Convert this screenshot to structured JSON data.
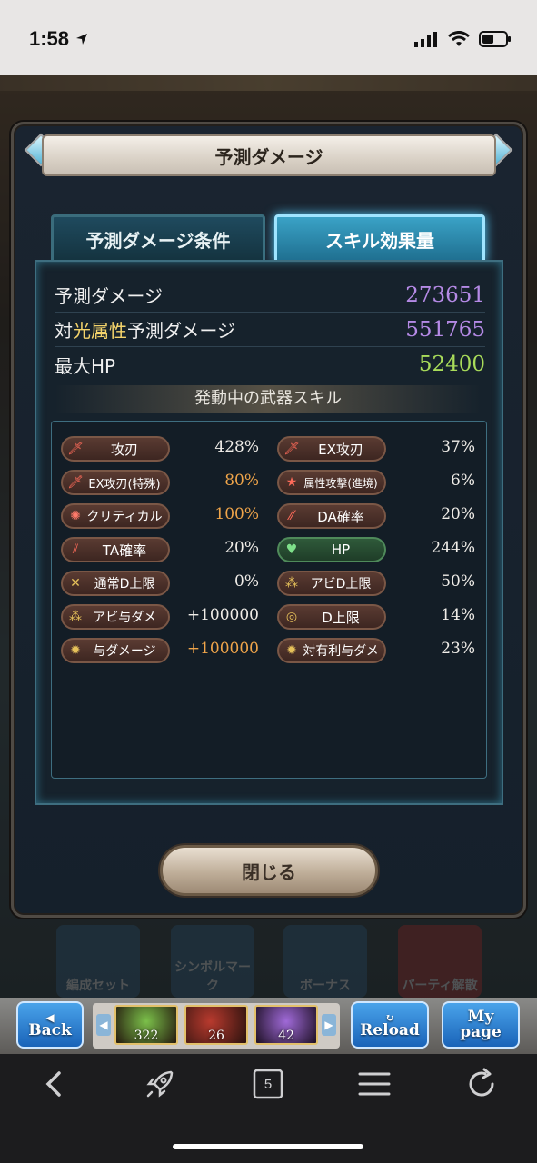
{
  "status_bar": {
    "time": "1:58"
  },
  "background": {
    "ghost_buttons": [
      "編成セット",
      "シンボルマーク",
      "ボーナス",
      "パーティ解散"
    ]
  },
  "modal": {
    "title": "予測ダメージ",
    "tabs": [
      {
        "label": "予測ダメージ条件",
        "active": false
      },
      {
        "label": "スキル効果量",
        "active": true
      }
    ],
    "stats": [
      {
        "label": "予測ダメージ",
        "value": "273651",
        "color": "#b58ae6"
      },
      {
        "label_prefix": "対",
        "label_highlight": "光属性",
        "label_suffix": "予測ダメージ",
        "value": "551765",
        "color": "#b58ae6"
      },
      {
        "label": "最大HP",
        "value": "52400",
        "color": "#a9dc5a"
      }
    ],
    "section_title": "発動中の武器スキル",
    "skills_left": [
      {
        "name": "攻刃",
        "value": "428%",
        "icon": "sword-icon"
      },
      {
        "name": "EX攻刃(特殊)",
        "value": "80%",
        "icon": "sword-icon",
        "value_color": "orange"
      },
      {
        "name": "クリティカル",
        "value": "100%",
        "icon": "burst-icon",
        "value_color": "orange"
      },
      {
        "name": "TA確率",
        "value": "20%",
        "icon": "triple-slash-icon"
      },
      {
        "name": "通常D上限",
        "value": "0%",
        "icon": "cap-icon"
      },
      {
        "name": "アビ与ダメ",
        "value": "+100000",
        "icon": "ability-icon"
      },
      {
        "name": "与ダメージ",
        "value": "+100000",
        "icon": "ring-icon",
        "value_color": "orange"
      }
    ],
    "skills_right": [
      {
        "name": "EX攻刃",
        "value": "37%",
        "icon": "sword-icon"
      },
      {
        "name": "属性攻撃(進境)",
        "value": "6%",
        "icon": "star-icon"
      },
      {
        "name": "DA確率",
        "value": "20%",
        "icon": "double-slash-icon"
      },
      {
        "name": "HP",
        "value": "244%",
        "icon": "heart-icon",
        "style": "green"
      },
      {
        "name": "アビD上限",
        "value": "50%",
        "icon": "ability-cap-icon"
      },
      {
        "name": "D上限",
        "value": "14%",
        "icon": "ring-icon"
      },
      {
        "name": "対有利与ダメ",
        "value": "23%",
        "icon": "gear-ring-icon"
      }
    ],
    "close_label": "閉じる"
  },
  "game_nav": {
    "back_label": "Back",
    "reload_label": "Reload",
    "mypage_label_top": "My",
    "mypage_label_bottom": "page",
    "summons": [
      {
        "count": "322"
      },
      {
        "count": "26"
      },
      {
        "count": "42"
      }
    ]
  },
  "browser_toolbar": {
    "tab_count": "5"
  }
}
